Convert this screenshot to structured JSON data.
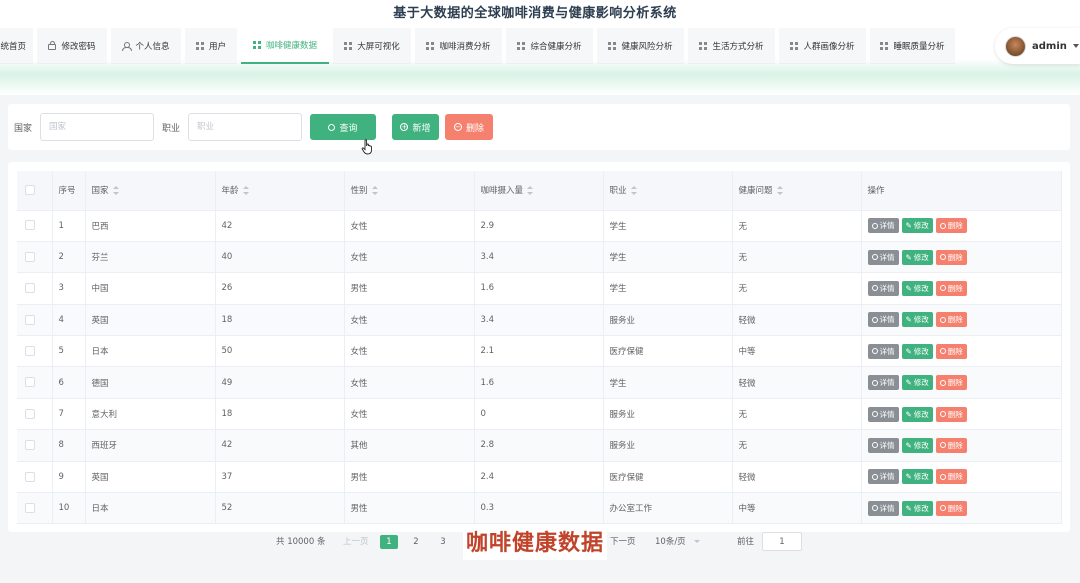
{
  "app_title": "基于大数据的全球咖啡消费与健康影响分析系统",
  "nav": {
    "items": [
      {
        "label": "系统首页",
        "icon": "home-icon",
        "active": false
      },
      {
        "label": "修改密码",
        "icon": "lock-icon",
        "active": false
      },
      {
        "label": "个人信息",
        "icon": "user-icon",
        "active": false
      },
      {
        "label": "用户",
        "icon": "grid-icon",
        "active": false
      },
      {
        "label": "咖啡健康数据",
        "icon": "grid-icon",
        "active": true
      },
      {
        "label": "大屏可视化",
        "icon": "grid-icon",
        "active": false
      },
      {
        "label": "咖啡消费分析",
        "icon": "grid-icon",
        "active": false
      },
      {
        "label": "综合健康分析",
        "icon": "grid-icon",
        "active": false
      },
      {
        "label": "健康风险分析",
        "icon": "grid-icon",
        "active": false
      },
      {
        "label": "生活方式分析",
        "icon": "grid-icon",
        "active": false
      },
      {
        "label": "人群画像分析",
        "icon": "grid-icon",
        "active": false
      },
      {
        "label": "睡眠质量分析",
        "icon": "grid-icon",
        "active": false
      }
    ],
    "user": {
      "name": "admin"
    }
  },
  "search": {
    "country_label": "国家",
    "country_placeholder": "国家",
    "job_label": "职业",
    "job_placeholder": "职业",
    "query_button": "查询",
    "add_button": "新增",
    "delete_button": "删除"
  },
  "table": {
    "headers": [
      "序号",
      "国家",
      "年龄",
      "性别",
      "咖啡摄入量",
      "职业",
      "健康问题",
      "操作"
    ],
    "action_labels": {
      "detail": "详情",
      "edit": "修改",
      "delete": "删除"
    },
    "rows": [
      {
        "no": "1",
        "country": "巴西",
        "age": "42",
        "gender": "女性",
        "coffee": "2.9",
        "job": "学生",
        "health": "无"
      },
      {
        "no": "2",
        "country": "芬兰",
        "age": "40",
        "gender": "女性",
        "coffee": "3.4",
        "job": "学生",
        "health": "无"
      },
      {
        "no": "3",
        "country": "中国",
        "age": "26",
        "gender": "男性",
        "coffee": "1.6",
        "job": "学生",
        "health": "无"
      },
      {
        "no": "4",
        "country": "英国",
        "age": "18",
        "gender": "女性",
        "coffee": "3.4",
        "job": "服务业",
        "health": "轻微"
      },
      {
        "no": "5",
        "country": "日本",
        "age": "50",
        "gender": "女性",
        "coffee": "2.1",
        "job": "医疗保健",
        "health": "中等"
      },
      {
        "no": "6",
        "country": "德国",
        "age": "49",
        "gender": "女性",
        "coffee": "1.6",
        "job": "学生",
        "health": "轻微"
      },
      {
        "no": "7",
        "country": "意大利",
        "age": "18",
        "gender": "女性",
        "coffee": "0",
        "job": "服务业",
        "health": "无"
      },
      {
        "no": "8",
        "country": "西班牙",
        "age": "42",
        "gender": "其他",
        "coffee": "2.8",
        "job": "服务业",
        "health": "无"
      },
      {
        "no": "9",
        "country": "英国",
        "age": "37",
        "gender": "男性",
        "coffee": "2.4",
        "job": "医疗保健",
        "health": "轻微"
      },
      {
        "no": "10",
        "country": "日本",
        "age": "52",
        "gender": "男性",
        "coffee": "0.3",
        "job": "办公室工作",
        "health": "中等"
      }
    ]
  },
  "pagination": {
    "total_text": "共 10000 条",
    "prev_text": "上一页",
    "pages": [
      "1",
      "2",
      "3"
    ],
    "next_text": "下一页",
    "page_size_text": "10条/页",
    "jump_label": "前往",
    "jump_value": "1"
  },
  "overlay_caption": "咖啡健康数据",
  "colors": {
    "accent": "#3fb27f",
    "danger": "#f4806d",
    "neutral": "#8a8f96",
    "caption": "#c0432a"
  }
}
